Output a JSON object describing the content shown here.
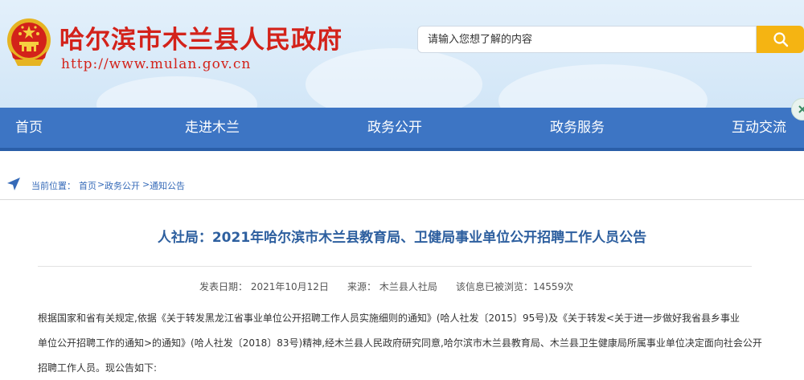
{
  "header": {
    "site_title": "哈尔滨市木兰县人民政府",
    "site_url": "http://www.mulan.gov.cn",
    "emblem_icon": "national-emblem-icon"
  },
  "search": {
    "placeholder": "请输入您想了解的内容",
    "button_icon": "search-icon"
  },
  "nav": {
    "items": [
      {
        "label": "首页"
      },
      {
        "label": "走进木兰"
      },
      {
        "label": "政务公开"
      },
      {
        "label": "政务服务"
      },
      {
        "label": "互动交流"
      }
    ]
  },
  "breadcrumb": {
    "label": "当前位置：",
    "items": [
      "首页",
      "政务公开",
      "通知公告"
    ],
    "separator": ">",
    "icon": "location-arrow-icon"
  },
  "article": {
    "title": "人社局：2021年哈尔滨市木兰县教育局、卫健局事业单位公开招聘工作人员公告",
    "meta": {
      "publish_date": "发表日期： 2021年10月12日",
      "source": "来源： 木兰县人社局",
      "views": "该信息已被浏览：14559次"
    },
    "lines": [
      "根据国家和省有关规定,依据《关于转发黑龙江省事业单位公开招聘工作人员实施细则的通知》(哈人社发〔2015〕95号)及《关于转发<关于进一步做好我省县乡事业",
      "单位公开招聘工作的通知>的通知》(哈人社发〔2018〕83号)精神,经木兰县人民政府研究同意,哈尔滨市木兰县教育局、木兰县卫生健康局所属事业单位决定面向社会公开",
      "招聘工作人员。现公告如下:"
    ]
  },
  "colors": {
    "title_red": "#d3221a",
    "nav_blue": "#3d75c4",
    "search_yellow": "#f5b412",
    "article_title_blue": "#2d5f9f"
  }
}
